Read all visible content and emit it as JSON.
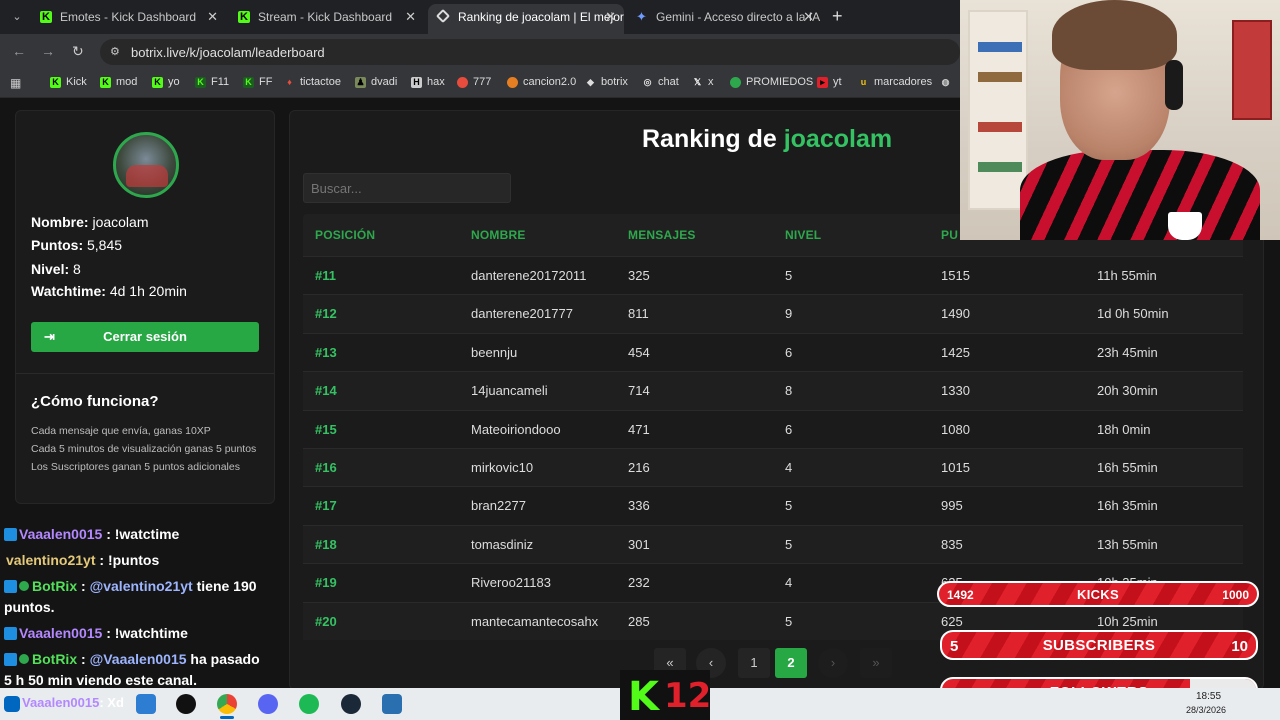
{
  "browser": {
    "tabs": [
      {
        "label": "Emotes - Kick Dashboard",
        "icon": "kick-icon",
        "active": false
      },
      {
        "label": "Stream - Kick Dashboard",
        "icon": "kick-icon",
        "active": false
      },
      {
        "label": "Ranking de joacolam | El mejor",
        "icon": "botrix-icon",
        "active": true
      },
      {
        "label": "Gemini - Acceso directo a la IA",
        "icon": "gemini-icon",
        "active": false
      }
    ],
    "new_tab": "+",
    "url": "botrix.live/k/joacolam/leaderboard",
    "bookmarks": [
      {
        "label": "Kick"
      },
      {
        "label": "mod"
      },
      {
        "label": "yo"
      },
      {
        "label": "F11"
      },
      {
        "label": "FF"
      },
      {
        "label": "tictactoe"
      },
      {
        "label": "dvadi"
      },
      {
        "label": "hax"
      },
      {
        "label": "777"
      },
      {
        "label": "cancion2.0"
      },
      {
        "label": "botrix"
      },
      {
        "label": "chat"
      },
      {
        "label": "x"
      },
      {
        "label": "PROMIEDOS"
      },
      {
        "label": "yt"
      },
      {
        "label": "marcadores"
      }
    ]
  },
  "profile": {
    "name_label": "Nombre:",
    "name": "joacolam",
    "points_label": "Puntos:",
    "points": "5,845",
    "level_label": "Nivel:",
    "level": "8",
    "watchtime_label": "Watchtime:",
    "watchtime": "4d 1h 20min",
    "logout_label": "Cerrar sesión",
    "how_title": "¿Cómo funciona?",
    "how_lines": [
      "Cada mensaje que envía, ganas 10XP",
      "Cada 5 minutos de visualización ganas 5 puntos",
      "Los Suscriptores ganan 5 puntos adicionales"
    ]
  },
  "ranking": {
    "title_prefix": "Ranking de",
    "title_user": "joacolam",
    "search_placeholder": "Buscar...",
    "columns": [
      "POSICIÓN",
      "NOMBRE",
      "MENSAJES",
      "NIVEL",
      "PU"
    ],
    "rows": [
      {
        "pos": "#11",
        "name": "danterene20172011",
        "messages": "325",
        "level": "5",
        "points": "1515",
        "watchtime": "11h 55min"
      },
      {
        "pos": "#12",
        "name": "danterene201777",
        "messages": "811",
        "level": "9",
        "points": "1490",
        "watchtime": "1d 0h 50min"
      },
      {
        "pos": "#13",
        "name": "beennju",
        "messages": "454",
        "level": "6",
        "points": "1425",
        "watchtime": "23h 45min"
      },
      {
        "pos": "#14",
        "name": "14juancameli",
        "messages": "714",
        "level": "8",
        "points": "1330",
        "watchtime": "20h 30min"
      },
      {
        "pos": "#15",
        "name": "Mateoiriondooo",
        "messages": "471",
        "level": "6",
        "points": "1080",
        "watchtime": "18h 0min"
      },
      {
        "pos": "#16",
        "name": "mirkovic10",
        "messages": "216",
        "level": "4",
        "points": "1015",
        "watchtime": "16h 55min"
      },
      {
        "pos": "#17",
        "name": "bran2277",
        "messages": "336",
        "level": "5",
        "points": "995",
        "watchtime": "16h 35min"
      },
      {
        "pos": "#18",
        "name": "tomasdiniz",
        "messages": "301",
        "level": "5",
        "points": "835",
        "watchtime": "13h 55min"
      },
      {
        "pos": "#19",
        "name": "Riveroo21183",
        "messages": "232",
        "level": "4",
        "points": "625",
        "watchtime": "10h 35min"
      },
      {
        "pos": "#20",
        "name": "mantecamantecosahx",
        "messages": "285",
        "level": "5",
        "points": "625",
        "watchtime": "10h 25min"
      }
    ],
    "pagination": {
      "first": "«",
      "prev": "‹",
      "pages": [
        "1",
        "2"
      ],
      "current": "2",
      "next": "›",
      "last": "»"
    }
  },
  "chat": [
    {
      "user": "Vaaalen0015",
      "sep": ":",
      "text": "!watctime"
    },
    {
      "user": "valentino21yt",
      "sep": ":",
      "text": "!puntos"
    },
    {
      "user": "BotRix",
      "sep": ":",
      "mention": "@valentino21yt",
      "text": "tiene 190",
      "text2": "puntos."
    },
    {
      "user": "Vaaalen0015",
      "sep": ":",
      "text": "!watchtime"
    },
    {
      "user": "BotRix",
      "sep": ":",
      "mention": "@Vaaalen0015",
      "text": "ha pasado",
      "text2": "5 h 50 min viendo este canal."
    }
  ],
  "goals": {
    "kicks": {
      "current": "1492",
      "label": "KICKS",
      "target": "1000"
    },
    "subscribers": {
      "current": "5",
      "label": "SUBSCRIBERS",
      "target": "10",
      "progress": 0.5
    },
    "followers": {
      "current": "239",
      "label": "FOLLOWERS",
      "target": "300",
      "progress": 0.8
    }
  },
  "overlay_logo": {
    "letter": "K",
    "number": "12"
  },
  "taskbar": {
    "chat_user": "Vaaalen0015",
    "chat_suffix": ": Xd",
    "time": "18:55",
    "date": "28/3/2026"
  },
  "colors": {
    "accent": "#28a745",
    "accent_text": "#34c263",
    "goal_red": "#e0202a",
    "background": "#141414"
  }
}
